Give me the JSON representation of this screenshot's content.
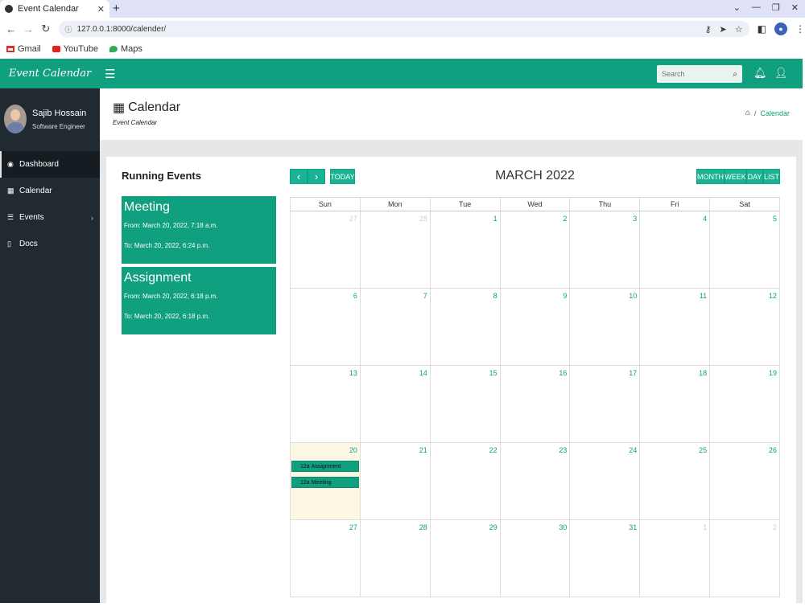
{
  "browser": {
    "tab_title": "Event Calendar",
    "tab_close": "✕",
    "new_tab": "+",
    "url": "127.0.0.1:8000/calender/",
    "window_controls": [
      "⌄",
      "—",
      "❐",
      "✕"
    ],
    "bookmarks": [
      {
        "label": "Gmail",
        "color": "#d93025"
      },
      {
        "label": "YouTube",
        "color": "#e62117"
      },
      {
        "label": "Maps",
        "color": "#34a853"
      }
    ]
  },
  "header": {
    "logo": "Event Calendar",
    "search_placeholder": "Search",
    "brand_color": "#109f7f"
  },
  "sidebar": {
    "user_name": "Sajib Hossain",
    "user_role": "Software Engineer",
    "items": [
      {
        "label": "Dashboard",
        "icon": "dashboard-icon",
        "glyph": "◉",
        "active": true
      },
      {
        "label": "Calendar",
        "icon": "calendar-icon",
        "glyph": "▦",
        "active": false
      },
      {
        "label": "Events",
        "icon": "list-icon",
        "glyph": "☰",
        "active": false,
        "chevron": "›"
      },
      {
        "label": "Docs",
        "icon": "document-icon",
        "glyph": "▯",
        "active": false
      }
    ]
  },
  "page": {
    "title": "Calendar",
    "subtitle": "Event Calendar",
    "breadcrumb_sep": "/",
    "breadcrumb_current": "Calendar"
  },
  "running_events": {
    "title": "Running Events",
    "events": [
      {
        "title": "Meeting",
        "from": "From: March 20, 2022, 7:18 a.m.",
        "to": "To: March 20, 2022, 6:24 p.m."
      },
      {
        "title": "Assignment",
        "from": "From: March 20, 2022, 6:18 p.m.",
        "to": "To: March 20, 2022, 6:18 p.m."
      }
    ]
  },
  "calendar": {
    "month_title": "MARCH 2022",
    "prev": "‹",
    "next": "›",
    "today": "TODAY",
    "views": [
      "MONTH",
      "WEEK",
      "DAY",
      "LIST"
    ],
    "weekdays": [
      "Sun",
      "Mon",
      "Tue",
      "Wed",
      "Thu",
      "Fri",
      "Sat"
    ],
    "weeks": [
      [
        {
          "d": "27",
          "other": true
        },
        {
          "d": "28",
          "other": true
        },
        {
          "d": "1"
        },
        {
          "d": "2"
        },
        {
          "d": "3"
        },
        {
          "d": "4"
        },
        {
          "d": "5"
        }
      ],
      [
        {
          "d": "6"
        },
        {
          "d": "7"
        },
        {
          "d": "8"
        },
        {
          "d": "9"
        },
        {
          "d": "10"
        },
        {
          "d": "11"
        },
        {
          "d": "12"
        }
      ],
      [
        {
          "d": "13"
        },
        {
          "d": "14"
        },
        {
          "d": "15"
        },
        {
          "d": "16"
        },
        {
          "d": "17"
        },
        {
          "d": "18"
        },
        {
          "d": "19"
        }
      ],
      [
        {
          "d": "20",
          "today": true,
          "events": [
            {
              "time": "12a",
              "title": "Assignment"
            },
            {
              "time": "12a",
              "title": "Meeting"
            }
          ]
        },
        {
          "d": "21"
        },
        {
          "d": "22"
        },
        {
          "d": "23"
        },
        {
          "d": "24"
        },
        {
          "d": "25"
        },
        {
          "d": "26"
        }
      ],
      [
        {
          "d": "27"
        },
        {
          "d": "28"
        },
        {
          "d": "29"
        },
        {
          "d": "30"
        },
        {
          "d": "31"
        },
        {
          "d": "1",
          "other": true
        },
        {
          "d": "2",
          "other": true
        }
      ]
    ]
  }
}
